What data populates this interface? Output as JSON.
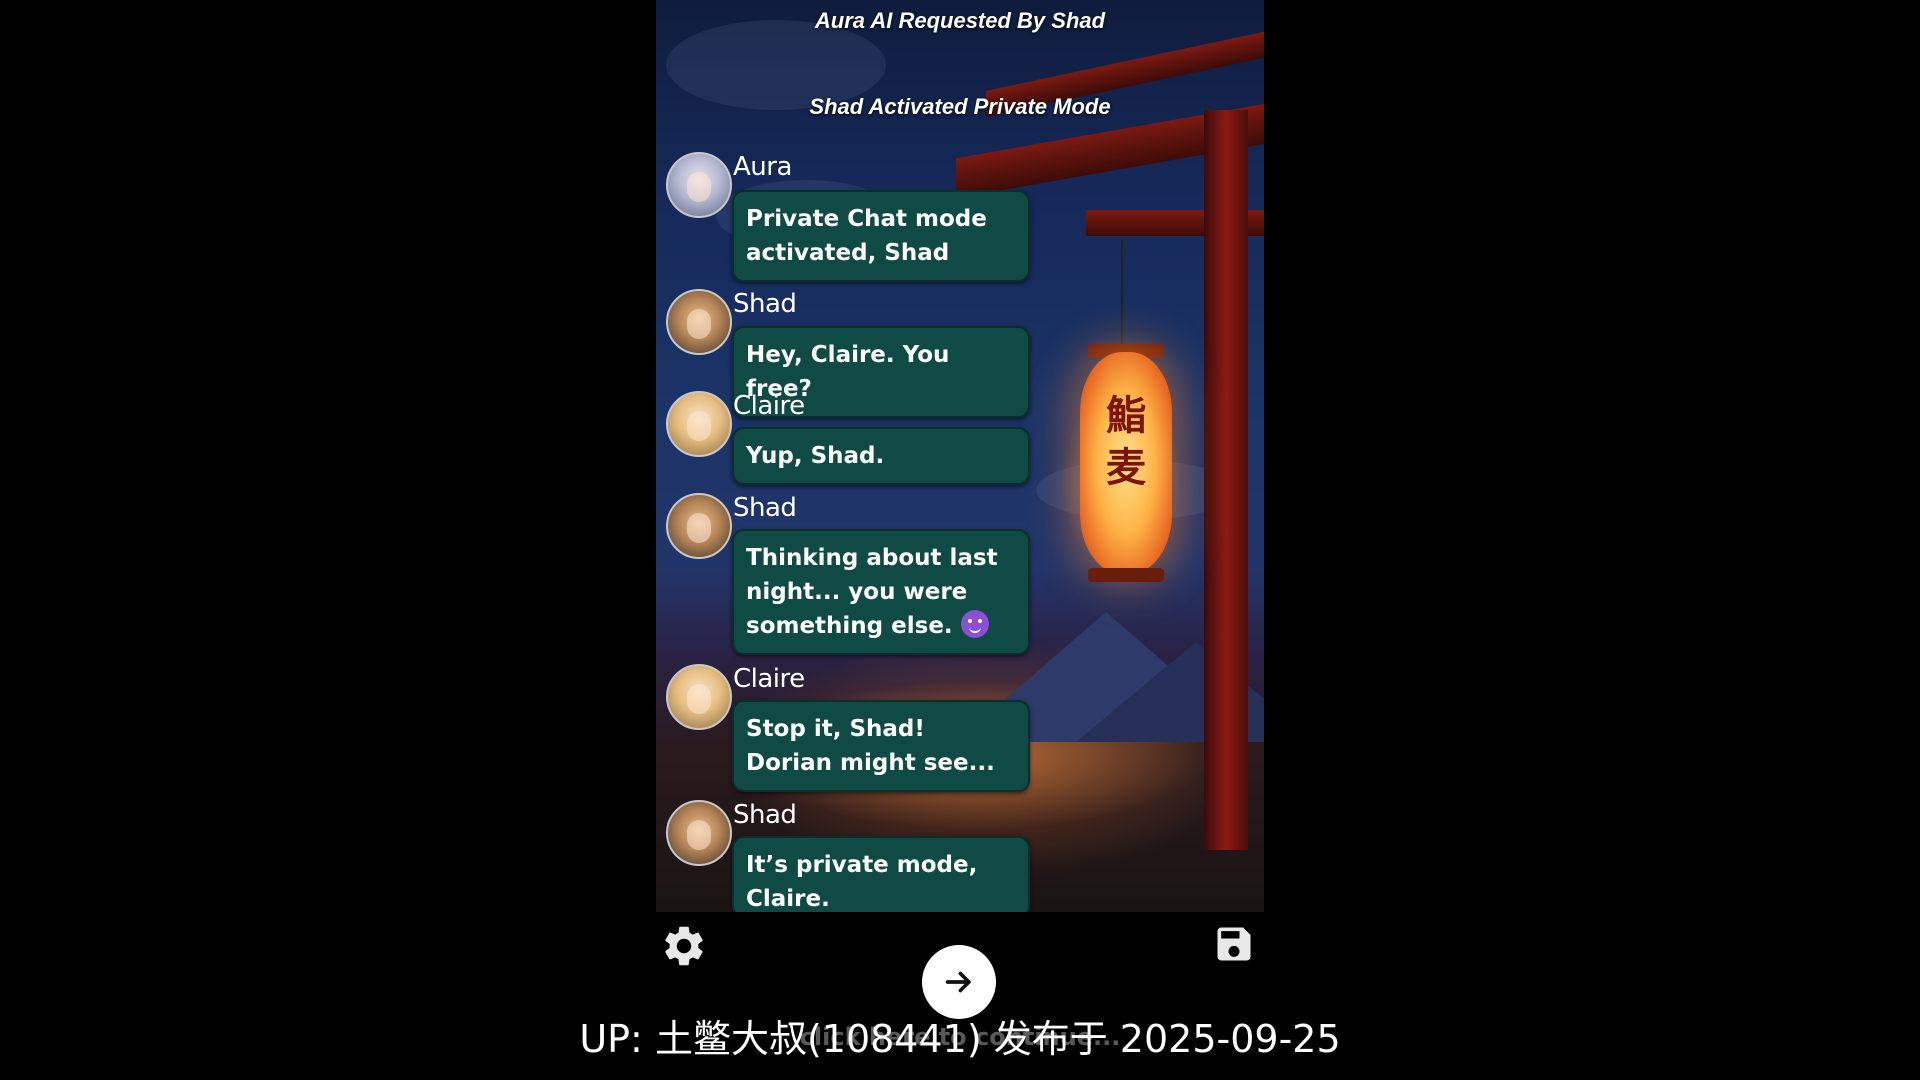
{
  "header": {
    "requested_by": "Aura AI Requested By Shad",
    "mode_notice": "Shad Activated Private Mode"
  },
  "messages": [
    {
      "sender": "Aura",
      "avatar": "aura-avatar",
      "text": "Private Chat mode activated, Shad"
    },
    {
      "sender": "Shad",
      "avatar": "shad-avatar",
      "text": "Hey, Claire. You free?"
    },
    {
      "sender": "Claire",
      "avatar": "claire-avatar",
      "text": "Yup, Shad."
    },
    {
      "sender": "Shad",
      "avatar": "shad-avatar",
      "text": "Thinking about last night... you were something else.",
      "emoji": "smiling-devil-emoji"
    },
    {
      "sender": "Claire",
      "avatar": "claire-avatar",
      "text": "Stop it, Shad! Dorian might see..."
    },
    {
      "sender": "Shad",
      "avatar": "shad-avatar",
      "text": "It’s private mode, Claire."
    }
  ],
  "controls": {
    "settings_icon": "gear-icon",
    "save_icon": "floppy-disk-icon",
    "next_icon": "arrow-right-icon"
  },
  "background": {
    "lantern_text": "鮨 麦"
  },
  "overlay": {
    "caption": "UP: 土鳖大叔(108441) 发布于 2025-09-25",
    "faded_text": "click here to continue..."
  },
  "colors": {
    "bubble": "#0f4a44",
    "bubble_text": "#ffffff",
    "page_background": "#000000"
  }
}
